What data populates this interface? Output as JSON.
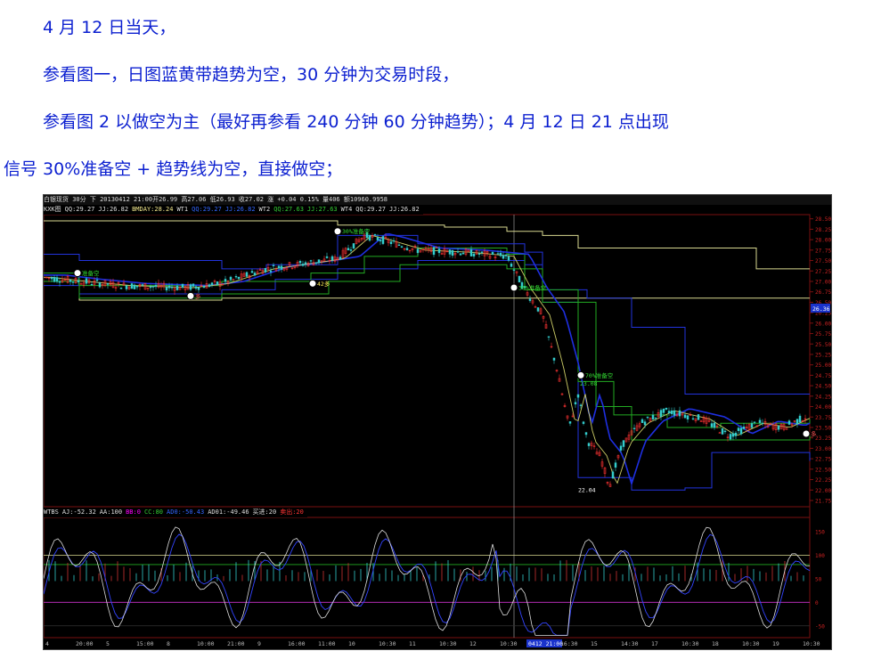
{
  "text": {
    "line1": "4 月 12 日当天，",
    "line2": "参看图一，日图蓝黄带趋势为空，30 分钟为交易时段，",
    "line3": "参看图 2 以做空为主（最好再参看 240 分钟  60 分钟趋势）；4 月 12 日 21 点出现",
    "line4": "信号  30%准备空  +  趋势线为空，直接做空；"
  },
  "chart": {
    "header_title": "白银现货  30分  下  20130412  21:00开26.99  高27.06  低26.93  收27.02  涨  +0.04  0.15%  量406  额10960.9958",
    "legend_main": [
      {
        "text": "KXK图",
        "color": "#dddddd"
      },
      {
        "text": "QQ:29.27",
        "color": "#dddddd"
      },
      {
        "text": "JJ:26.82",
        "color": "#dddddd"
      },
      {
        "text": "BMDAY:28.24",
        "color": "#f0e68c"
      },
      {
        "text": "WT1",
        "color": "#dddddd"
      },
      {
        "text": "QQ:29.27",
        "color": "#3366ff"
      },
      {
        "text": "JJ:26.82",
        "color": "#3366ff"
      },
      {
        "text": "WT2",
        "color": "#dddddd"
      },
      {
        "text": "QQ:27.63",
        "color": "#33cc33"
      },
      {
        "text": "JJ:27.63",
        "color": "#33cc33"
      },
      {
        "text": "WT4",
        "color": "#dddddd"
      },
      {
        "text": "QQ:29.27",
        "color": "#dddddd"
      },
      {
        "text": "JJ:26.82",
        "color": "#dddddd"
      }
    ],
    "legend_ind": [
      {
        "text": "WTBS",
        "color": "#dddddd"
      },
      {
        "text": "AJ:-52.32",
        "color": "#dddddd"
      },
      {
        "text": "AA:100",
        "color": "#dddddd"
      },
      {
        "text": "BB:0",
        "color": "#ff00ff"
      },
      {
        "text": "CC:80",
        "color": "#33cc33"
      },
      {
        "text": "AD0:-50.43",
        "color": "#3366ff"
      },
      {
        "text": "AD01:-49.46",
        "color": "#dddddd"
      },
      {
        "text": "买进:20",
        "color": "#dddddd"
      },
      {
        "text": "卖出:20",
        "color": "#ff3333"
      }
    ],
    "price_axis": [
      "28.50",
      "28.25",
      "28.00",
      "27.75",
      "27.50",
      "27.25",
      "27.00",
      "26.75",
      "26.50",
      "26.25",
      "26.00",
      "25.75",
      "25.50",
      "25.25",
      "25.00",
      "24.75",
      "24.50",
      "24.25",
      "24.00",
      "23.75",
      "23.50",
      "23.25",
      "23.00",
      "22.75",
      "22.50",
      "22.25",
      "22.00",
      "21.75"
    ],
    "current_price": "26.36",
    "ind_axis": [
      "150",
      "100",
      "50",
      "0",
      "-50"
    ],
    "time_axis": [
      "4",
      "20:00",
      "5",
      "15:00",
      "8",
      "10:00",
      "21:00",
      "9",
      "16:00",
      "11:00",
      "10",
      "10:30",
      "11",
      "10:30",
      "12",
      "10:30",
      "0412 21:00",
      "16:30",
      "15",
      "14:30",
      "17",
      "10:30",
      "18",
      "10:30",
      "19",
      "10:30"
    ],
    "annotations": {
      "sig1": "准备空",
      "sig2": "30%准备空",
      "sig3": "42多",
      "sig4": "30%准备空",
      "sig5": "70%准备空",
      "sig6": "23.08",
      "low": "22.04",
      "sig7": "多"
    },
    "colors": {
      "bg": "#000000",
      "up": "#ff3333",
      "down": "#33cccc",
      "grid": "#7a1010",
      "blue_band": "#2233dd",
      "yellow_line": "#d8d890",
      "green_line": "#22aa22"
    }
  }
}
